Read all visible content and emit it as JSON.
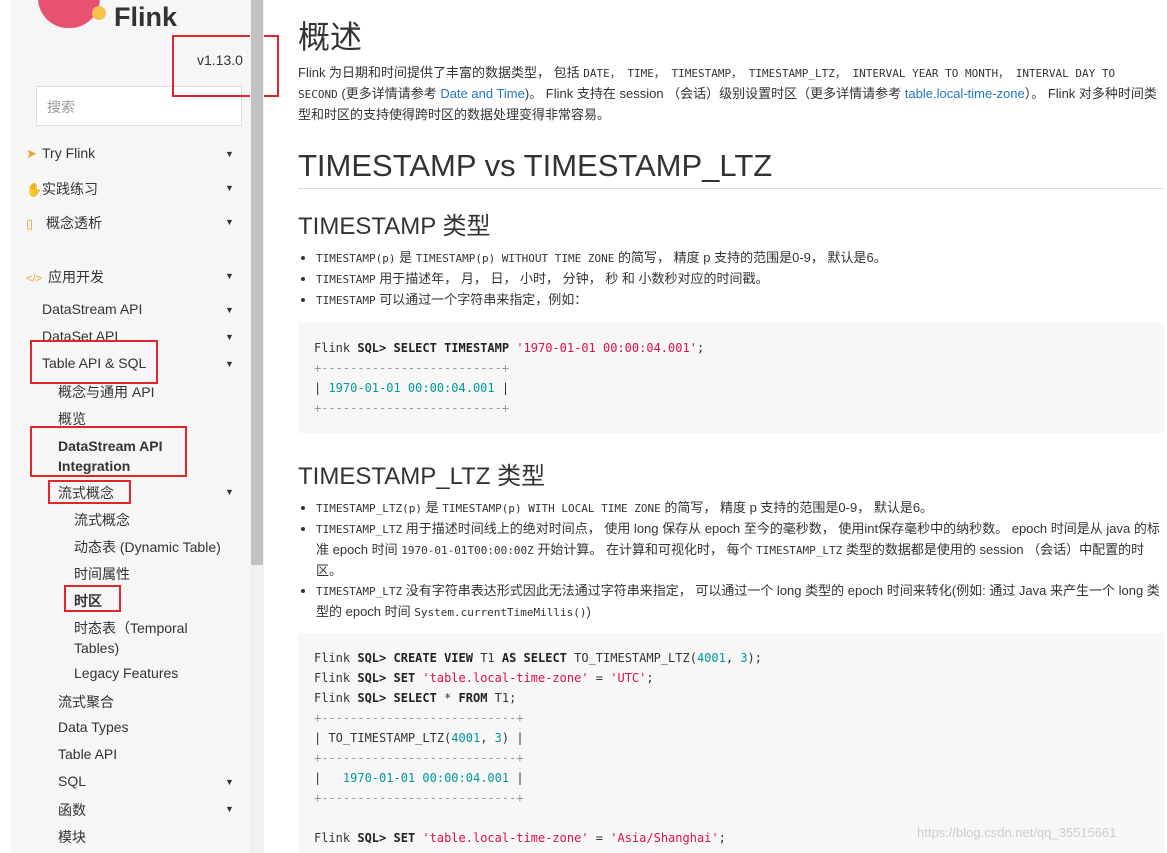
{
  "sidebar": {
    "logo_text": "Flink",
    "version": "v1.13.0",
    "search_placeholder": "搜索",
    "items": [
      {
        "label": "Try Flink",
        "icon": "rocket-icon"
      },
      {
        "label": "实践练习",
        "icon": "hand-icon"
      },
      {
        "label": "概念透析",
        "icon": "map-icon"
      },
      {
        "label": "应用开发",
        "icon": "code-icon"
      },
      {
        "label": "DataStream API"
      },
      {
        "label": "DataSet API"
      },
      {
        "label": "Table API & SQL"
      },
      {
        "label": "概念与通用 API"
      },
      {
        "label": "概览"
      },
      {
        "label": "DataStream API"
      },
      {
        "label": "Integration"
      },
      {
        "label": "流式概念"
      },
      {
        "label": "流式概念"
      },
      {
        "label": "动态表 (Dynamic Table)"
      },
      {
        "label": "时间属性"
      },
      {
        "label": "时区"
      },
      {
        "label": "时态表（Temporal"
      },
      {
        "label": "Tables)"
      },
      {
        "label": "Legacy Features"
      },
      {
        "label": "流式聚合"
      },
      {
        "label": "Data Types"
      },
      {
        "label": "Table API"
      },
      {
        "label": "SQL"
      },
      {
        "label": "函数"
      },
      {
        "label": "模块"
      }
    ]
  },
  "main": {
    "title": "概述",
    "intro": {
      "t1": "Flink 为日期和时间提供了丰富的数据类型， 包括 ",
      "c1": "DATE， TIME， TIMESTAMP， TIMESTAMP_LTZ， INTERVAL YEAR TO MONTH， INTERVAL DAY TO SECOND",
      "t2": " (更多详情请参考 ",
      "link1": "Date and Time",
      "t3": ")。 Flink 支持在 session （会话）级别设置时区（更多详情请参考 ",
      "link2": "table.local-time-zone",
      "t4": "）。 Flink 对多种时间类型和时区的支持使得跨时区的数据处理变得非常容易。"
    },
    "h2": "TIMESTAMP vs TIMESTAMP_LTZ",
    "sec1": {
      "title": "TIMESTAMP 类型",
      "b1_code1": "TIMESTAMP(p)",
      "b1_t1": " 是 ",
      "b1_code2": "TIMESTAMP(p) WITHOUT TIME ZONE",
      "b1_t2": " 的简写， 精度 p 支持的范围是0-9， 默认是6。",
      "b2_code": "TIMESTAMP",
      "b2_t": " 用于描述年， 月， 日， 小时， 分钟， 秒 和 小数秒对应的时间戳。",
      "b3_code": "TIMESTAMP",
      "b3_t": " 可以通过一个字符串来指定，例如："
    },
    "code1": {
      "prompt": "Flink ",
      "sql": "SQL>",
      "kw1": " SELECT TIMESTAMP ",
      "str1": "'1970-01-01 00:00:04.001'",
      "end": ";",
      "border": "+-------------------------+",
      "row_pre": "| ",
      "row_val": "1970-01-01 00:00:04.001",
      "row_post": " |"
    },
    "sec2": {
      "title": "TIMESTAMP_LTZ 类型",
      "b1_code1": "TIMESTAMP_LTZ(p)",
      "b1_t1": " 是 ",
      "b1_code2": "TIMESTAMP(p) WITH LOCAL TIME ZONE",
      "b1_t2": " 的简写， 精度 p 支持的范围是0-9， 默认是6。",
      "b2_code1": "TIMESTAMP_LTZ",
      "b2_t1": " 用于描述时间线上的绝对时间点， 使用 long 保存从 epoch 至今的毫秒数， 使用int保存毫秒中的纳秒数。 epoch 时间是从 java 的标准 epoch 时间 ",
      "b2_code2": "1970-01-01T00:00:00Z",
      "b2_t2": " 开始计算。 在计算和可视化时， 每个 ",
      "b2_code3": "TIMESTAMP_LTZ",
      "b2_t3": " 类型的数据都是使用的 session （会话）中配置的时区。",
      "b3_code1": "TIMESTAMP_LTZ",
      "b3_t1": " 没有字符串表达形式因此无法通过字符串来指定， 可以通过一个 long 类型的 epoch 时间来转化(例如: 通过 Java 来产生一个 long 类型的 epoch 时间 ",
      "b3_code2": "System.currentTimeMillis()",
      "b3_t2": ")"
    },
    "code2": {
      "l1_prompt": "Flink ",
      "l1_sql": "SQL>",
      "l1_kw": " CREATE VIEW ",
      "l1_t1": "T1 ",
      "l1_kw2": "AS SELECT ",
      "l1_t2": "TO_TIMESTAMP_LTZ(",
      "l1_n1": "4001",
      "l1_t3": ", ",
      "l1_n2": "3",
      "l1_t4": ");",
      "l2_prompt": "Flink ",
      "l2_sql": "SQL>",
      "l2_kw": " SET ",
      "l2_s1": "'table.local-time-zone'",
      "l2_t": " = ",
      "l2_s2": "'UTC'",
      "l2_end": ";",
      "l3_prompt": "Flink ",
      "l3_sql": "SQL>",
      "l3_kw": " SELECT ",
      "l3_t1": "* ",
      "l3_kw2": "FROM ",
      "l3_t2": "T1;",
      "border": "+---------------------------+",
      "h_pre": "| TO_TIMESTAMP_LTZ(",
      "h_n1": "4001",
      "h_mid": ", ",
      "h_n2": "3",
      "h_post": ") |",
      "r_pre": "|   ",
      "r_val": "1970-01-01",
      "r_sp": " ",
      "r_time": "00:00:04.001",
      "r_post": " |",
      "l4_prompt": "Flink ",
      "l4_sql": "SQL>",
      "l4_kw": " SET ",
      "l4_s1": "'table.local-time-zone'",
      "l4_t": " = ",
      "l4_s2": "'Asia/Shanghai'",
      "l4_end": ";"
    },
    "watermark": "https://blog.csdn.net/qq_35515661"
  },
  "colors": {
    "annotation_red": "#e1252b",
    "link": "#2276c4",
    "string": "#dd1144",
    "number": "#009999"
  }
}
